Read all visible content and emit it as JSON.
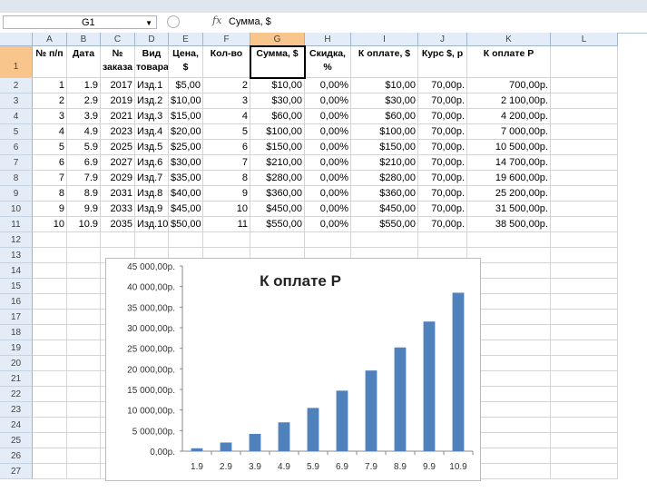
{
  "formula_bar": {
    "name_box": "G1",
    "formula": "Сумма, $"
  },
  "columns": [
    "A",
    "B",
    "C",
    "D",
    "E",
    "F",
    "G",
    "H",
    "I",
    "J",
    "K",
    "L"
  ],
  "rows": [
    "1",
    "2",
    "3",
    "4",
    "5",
    "6",
    "7",
    "8",
    "9",
    "10",
    "11",
    "12",
    "13",
    "14",
    "15",
    "16",
    "17",
    "18",
    "19",
    "20",
    "21",
    "22",
    "23",
    "24",
    "25",
    "26",
    "27"
  ],
  "selected_cell": "G1",
  "table": {
    "headers": [
      "№ п/п",
      "Дата",
      "№ заказа",
      "Вид товара",
      "Цена, $",
      "Кол-во",
      "Сумма, $",
      "Скидка, %",
      "К оплате, $",
      "Курс $, р",
      "К оплате Р"
    ],
    "rows": [
      [
        "1",
        "1.9",
        "2017",
        "Изд.1",
        "$5,00",
        "2",
        "$10,00",
        "0,00%",
        "$10,00",
        "70,00р.",
        "700,00р."
      ],
      [
        "2",
        "2.9",
        "2019",
        "Изд.2",
        "$10,00",
        "3",
        "$30,00",
        "0,00%",
        "$30,00",
        "70,00р.",
        "2 100,00р."
      ],
      [
        "3",
        "3.9",
        "2021",
        "Изд.3",
        "$15,00",
        "4",
        "$60,00",
        "0,00%",
        "$60,00",
        "70,00р.",
        "4 200,00р."
      ],
      [
        "4",
        "4.9",
        "2023",
        "Изд.4",
        "$20,00",
        "5",
        "$100,00",
        "0,00%",
        "$100,00",
        "70,00р.",
        "7 000,00р."
      ],
      [
        "5",
        "5.9",
        "2025",
        "Изд.5",
        "$25,00",
        "6",
        "$150,00",
        "0,00%",
        "$150,00",
        "70,00р.",
        "10 500,00р."
      ],
      [
        "6",
        "6.9",
        "2027",
        "Изд.6",
        "$30,00",
        "7",
        "$210,00",
        "0,00%",
        "$210,00",
        "70,00р.",
        "14 700,00р."
      ],
      [
        "7",
        "7.9",
        "2029",
        "Изд.7",
        "$35,00",
        "8",
        "$280,00",
        "0,00%",
        "$280,00",
        "70,00р.",
        "19 600,00р."
      ],
      [
        "8",
        "8.9",
        "2031",
        "Изд.8",
        "$40,00",
        "9",
        "$360,00",
        "0,00%",
        "$360,00",
        "70,00р.",
        "25 200,00р."
      ],
      [
        "9",
        "9.9",
        "2033",
        "Изд.9",
        "$45,00",
        "10",
        "$450,00",
        "0,00%",
        "$450,00",
        "70,00р.",
        "31 500,00р."
      ],
      [
        "10",
        "10.9",
        "2035",
        "Изд.10",
        "$50,00",
        "11",
        "$550,00",
        "0,00%",
        "$550,00",
        "70,00р.",
        "38 500,00р."
      ]
    ]
  },
  "chart_data": {
    "type": "bar",
    "title": "К оплате Р",
    "categories": [
      "1.9",
      "2.9",
      "3.9",
      "4.9",
      "5.9",
      "6.9",
      "7.9",
      "8.9",
      "9.9",
      "10.9"
    ],
    "values": [
      700,
      2100,
      4200,
      7000,
      10500,
      14700,
      19600,
      25200,
      31500,
      38500
    ],
    "ylim": [
      0,
      45000
    ],
    "ytick_values": [
      0,
      5000,
      10000,
      15000,
      20000,
      25000,
      30000,
      35000,
      40000,
      45000
    ],
    "ytick_labels": [
      "0,00р.",
      "5 000,00р.",
      "10 000,00р.",
      "15 000,00р.",
      "20 000,00р.",
      "25 000,00р.",
      "30 000,00р.",
      "35 000,00р.",
      "40 000,00р.",
      "45 000,00р."
    ],
    "bar_color": "#4f81bd",
    "legend": "none",
    "grid": false
  }
}
